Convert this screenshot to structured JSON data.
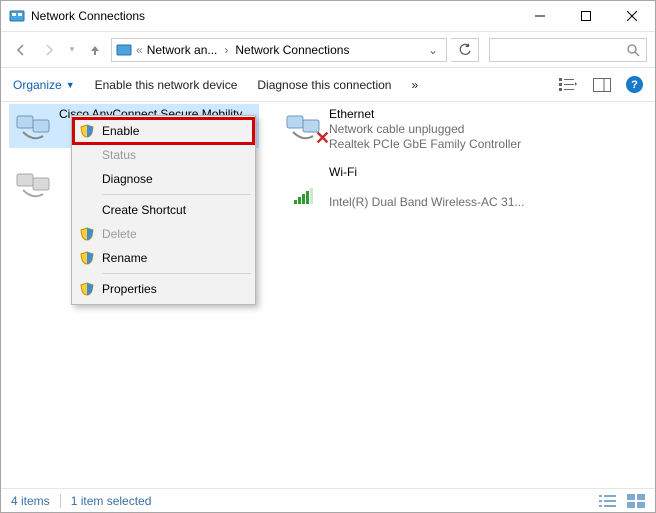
{
  "window": {
    "title": "Network Connections"
  },
  "breadcrumb": {
    "root": "Network an...",
    "leaf": "Network Connections"
  },
  "commandbar": {
    "organize": "Organize",
    "enable_device": "Enable this network device",
    "diagnose": "Diagnose this connection",
    "more": "»",
    "help": "?"
  },
  "adapters": {
    "cisco": {
      "name": "Cisco AnyConnect Secure Mobility"
    },
    "ethernet": {
      "name": "Ethernet",
      "status": "Network cable unplugged",
      "device": "Realtek PCIe GbE Family Controller"
    },
    "wifi": {
      "name": "Wi-Fi",
      "device": "Intel(R) Dual Band Wireless-AC 31..."
    }
  },
  "context_menu": {
    "enable": "Enable",
    "status": "Status",
    "diagnose": "Diagnose",
    "create_shortcut": "Create Shortcut",
    "delete": "Delete",
    "rename": "Rename",
    "properties": "Properties"
  },
  "statusbar": {
    "count": "4 items",
    "selection": "1 item selected"
  }
}
